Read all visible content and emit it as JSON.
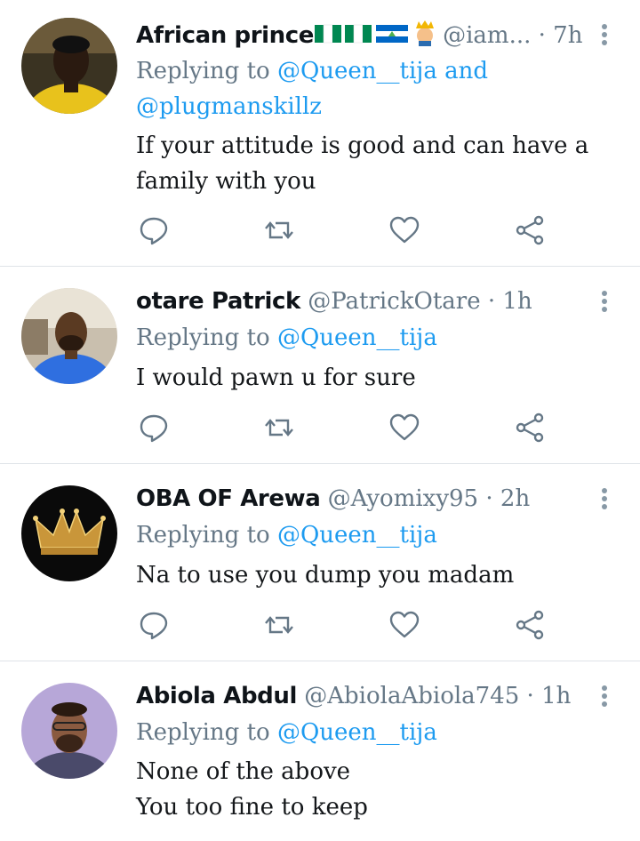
{
  "tweets": [
    {
      "name": "African prince",
      "handle": "@iam...",
      "dot": " · ",
      "time": "7h",
      "replying_prefix": "Replying to ",
      "replying_line1": "@Queen__tija and",
      "replying_line2": "@plugmanskillz",
      "text_lines": [
        "If your attitude is good and can have a",
        "family with you"
      ],
      "avatar_icon": "profile-photo-man-yellow-shirt"
    },
    {
      "name": "otare Patrick",
      "handle": "@PatrickOtare",
      "dot": " · ",
      "time": "1h",
      "replying_prefix": "Replying to ",
      "replying_line1": "@Queen__tija",
      "text_lines": [
        "I would pawn u for sure"
      ],
      "avatar_icon": "profile-photo-man-blue-shirt"
    },
    {
      "name": "OBA OF Arewa",
      "handle": "@Ayomixy95",
      "dot": " · ",
      "time": "2h",
      "replying_prefix": "Replying to ",
      "replying_line1": "@Queen__tija",
      "text_lines": [
        "Na to use you dump you madam"
      ],
      "avatar_icon": "gold-crown-logo"
    },
    {
      "name": "Abiola Abdul",
      "handle": "@AbiolaAbiola745",
      "dot": " · ",
      "time": "1h",
      "replying_prefix": "Replying to ",
      "replying_line1": "@Queen__tija",
      "text_lines": [
        "None of the above",
        "You too fine to keep"
      ],
      "avatar_icon": "profile-photo-man-glasses"
    }
  ],
  "icons": {
    "reply": "reply-icon",
    "retweet": "retweet-icon",
    "like": "heart-icon",
    "share": "share-icon",
    "more": "more-options-icon"
  },
  "colors": {
    "name": "#0f1419",
    "secondary": "#657786",
    "link": "#1d9bf0",
    "icon": "#657786",
    "divider": "#dfe3e8"
  }
}
